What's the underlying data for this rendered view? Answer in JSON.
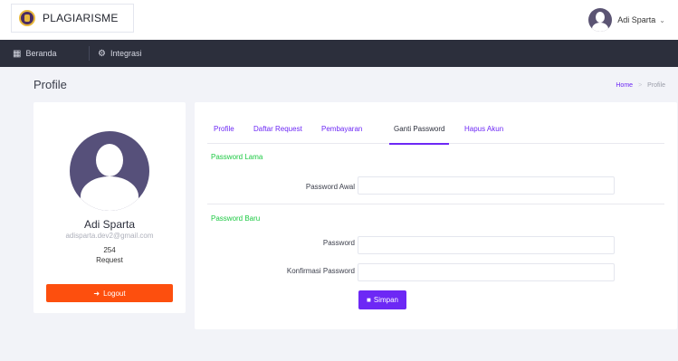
{
  "app": {
    "brand": "PLAGIARISME",
    "user_name": "Adi Sparta"
  },
  "nav": {
    "items": [
      {
        "label": "Beranda",
        "icon": "dashboard-icon"
      },
      {
        "label": "Integrasi",
        "icon": "cogs-icon"
      }
    ]
  },
  "page": {
    "title": "Profile",
    "breadcrumb": {
      "home": "Home",
      "current": "Profile"
    }
  },
  "profile": {
    "name": "Adi Sparta",
    "email": "adisparta.dev2@gmail.com",
    "request_count": "254",
    "request_label": "Request",
    "logout_label": "Logout"
  },
  "tabs": [
    "Profile",
    "Daftar Request",
    "Pembayaran",
    "Ganti Password",
    "Hapus Akun"
  ],
  "active_tab": "Ganti Password",
  "form": {
    "old_section": "Password Lama",
    "old_label": "Password Awal",
    "old_value": "",
    "new_section": "Password Baru",
    "new_label": "Password",
    "new_value": "",
    "confirm_label": "Konfirmasi Password",
    "confirm_value": "",
    "save_label": "Simpan"
  },
  "colors": {
    "accent": "#6d28f5",
    "logout": "#fd4f0e",
    "section": "#1dc943",
    "navbar": "#2c2f3c"
  }
}
